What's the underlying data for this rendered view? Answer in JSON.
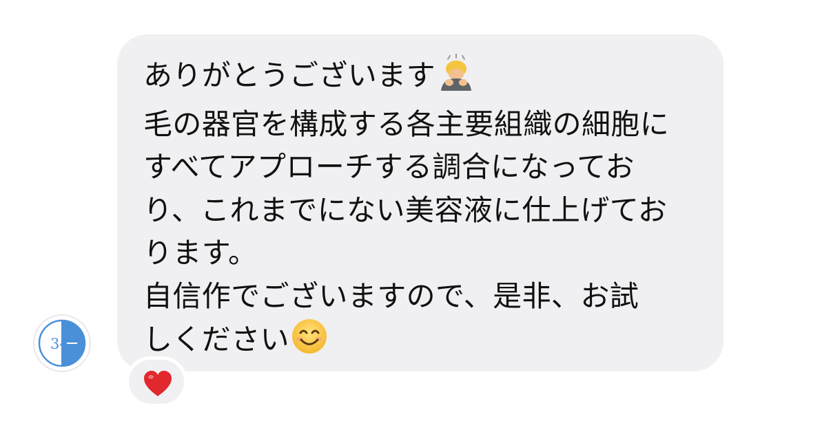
{
  "message": {
    "lines": [
      "ありがとうございます",
      "毛の器官を構成する各主要組織の細胞に",
      "すべてアプローチする調合になってお",
      "り、これまでにない美容液に仕上げてお",
      "ります。",
      "自信作でございますので、是非、お試",
      "しください"
    ],
    "emoji_after_line_1": "person-bowing-icon",
    "emoji_after_line_7": "smiling-face-icon"
  },
  "avatar": {
    "text": "34",
    "accent_color": "#4a90d9"
  },
  "reaction": {
    "icon": "red-heart-icon",
    "color": "#e0282e"
  },
  "colors": {
    "bubble_background": "#f0f0f2",
    "text": "#111111"
  }
}
